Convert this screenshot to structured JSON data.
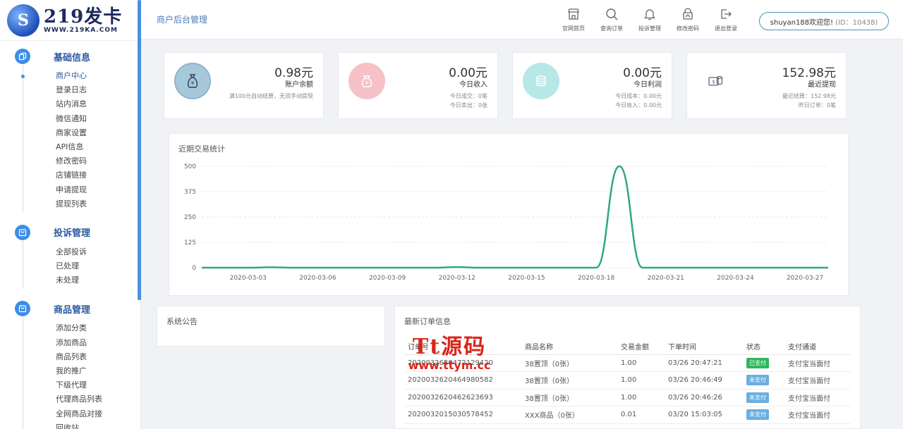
{
  "brand": {
    "title": "219发卡",
    "subtitle": "WWW.219KA.COM",
    "mark": "S"
  },
  "header": {
    "breadcrumb": "商户后台管理",
    "buttons": [
      {
        "label": "官网首页",
        "icon": "store-icon"
      },
      {
        "label": "查询订单",
        "icon": "search-icon"
      },
      {
        "label": "投诉管理",
        "icon": "bell-icon"
      },
      {
        "label": "修改密码",
        "icon": "edit-lock-icon"
      },
      {
        "label": "退出登录",
        "icon": "logout-icon"
      }
    ],
    "user_greeting": "shuyan188欢迎您!",
    "user_id": "(ID：10438)"
  },
  "sidebar": {
    "groups": [
      {
        "title": "基础信息",
        "icon": "copy-icon",
        "items": [
          "商户中心",
          "登录日志",
          "站内消息",
          "微信通知",
          "商家设置",
          "API信息",
          "修改密码",
          "店铺链接",
          "申请提现",
          "提现列表"
        ]
      },
      {
        "title": "投诉管理",
        "icon": "bag-icon",
        "items": [
          "全部投诉",
          "已处理",
          "未处理"
        ]
      },
      {
        "title": "商品管理",
        "icon": "bag-icon",
        "items": [
          "添加分类",
          "添加商品",
          "商品列表",
          "我的推广",
          "下级代理",
          "代理商品列表",
          "全网商品对接",
          "回收站"
        ]
      }
    ]
  },
  "cards": [
    {
      "value": "0.98元",
      "label": "账户余额",
      "sub": [
        "满100元自动结算，无须手动提现"
      ],
      "icon": "money-bag-icon",
      "color": "#a7c8db"
    },
    {
      "value": "0.00元",
      "label": "今日收入",
      "sub": [
        "今日成交：0笔",
        "今日卖出：0张"
      ],
      "icon": "yen-bag-icon",
      "color": "#f6c2c8"
    },
    {
      "value": "0.00元",
      "label": "今日利润",
      "sub": [
        "今日成本：0.00元",
        "今日收入：0.00元"
      ],
      "icon": "coins-icon",
      "color": "#b7e7e7"
    },
    {
      "value": "152.98元",
      "label": "最近提现",
      "sub": [
        "最近结算：152.98元",
        "昨日订单：0笔"
      ],
      "icon": "cash-icon",
      "color": "#ffffff"
    }
  ],
  "chart_title": "近期交易统计",
  "chart_data": {
    "type": "line",
    "title": "近期交易统计",
    "x": [
      "2020-03-01",
      "2020-03-02",
      "2020-03-03",
      "2020-03-04",
      "2020-03-05",
      "2020-03-06",
      "2020-03-07",
      "2020-03-08",
      "2020-03-09",
      "2020-03-10",
      "2020-03-11",
      "2020-03-12",
      "2020-03-13",
      "2020-03-14",
      "2020-03-15",
      "2020-03-16",
      "2020-03-17",
      "2020-03-18",
      "2020-03-19",
      "2020-03-20",
      "2020-03-21",
      "2020-03-22",
      "2020-03-23",
      "2020-03-24",
      "2020-03-25",
      "2020-03-26",
      "2020-03-27",
      "2020-03-28"
    ],
    "tick_labels": [
      "2020-03-03",
      "2020-03-06",
      "2020-03-09",
      "2020-03-12",
      "2020-03-15",
      "2020-03-18",
      "2020-03-21",
      "2020-03-24",
      "2020-03-27"
    ],
    "series": [
      {
        "values": [
          0,
          0,
          0,
          2,
          0,
          0,
          0,
          0,
          0,
          0,
          0,
          3,
          0,
          0,
          0,
          0,
          0,
          0,
          500,
          0,
          0,
          0,
          0,
          0,
          0,
          0,
          0,
          0
        ]
      }
    ],
    "yticks": [
      0,
      125,
      250,
      375,
      500
    ],
    "ylim": [
      0,
      500
    ],
    "color": "#2eaa78",
    "grid": "horizontal"
  },
  "notice": {
    "title": "系统公告"
  },
  "orders": {
    "title": "最新订单信息",
    "columns": [
      "订单号",
      "商品名称",
      "交易金额",
      "下单时间",
      "状态",
      "支付通道"
    ],
    "rows": [
      {
        "id": "2020032620472129420",
        "name": "38置顶（0张）",
        "amount": "1.00",
        "time": "03/26 20:47:21",
        "status": "已支付",
        "paid": true,
        "channel": "支付宝当面付"
      },
      {
        "id": "2020032620464980582",
        "name": "38置顶（0张）",
        "amount": "1.00",
        "time": "03/26 20:46:49",
        "status": "未支付",
        "paid": false,
        "channel": "支付宝当面付"
      },
      {
        "id": "2020032620462623693",
        "name": "38置顶（0张）",
        "amount": "1.00",
        "time": "03/26 20:46:26",
        "status": "未支付",
        "paid": false,
        "channel": "支付宝当面付"
      },
      {
        "id": "2020032015030578452",
        "name": "XXX商品（0张）",
        "amount": "0.01",
        "time": "03/20 15:03:05",
        "status": "未支付",
        "paid": false,
        "channel": "支付宝当面付"
      }
    ]
  },
  "watermark": {
    "text": "Tt源码",
    "url": "www.ttym.cc"
  }
}
